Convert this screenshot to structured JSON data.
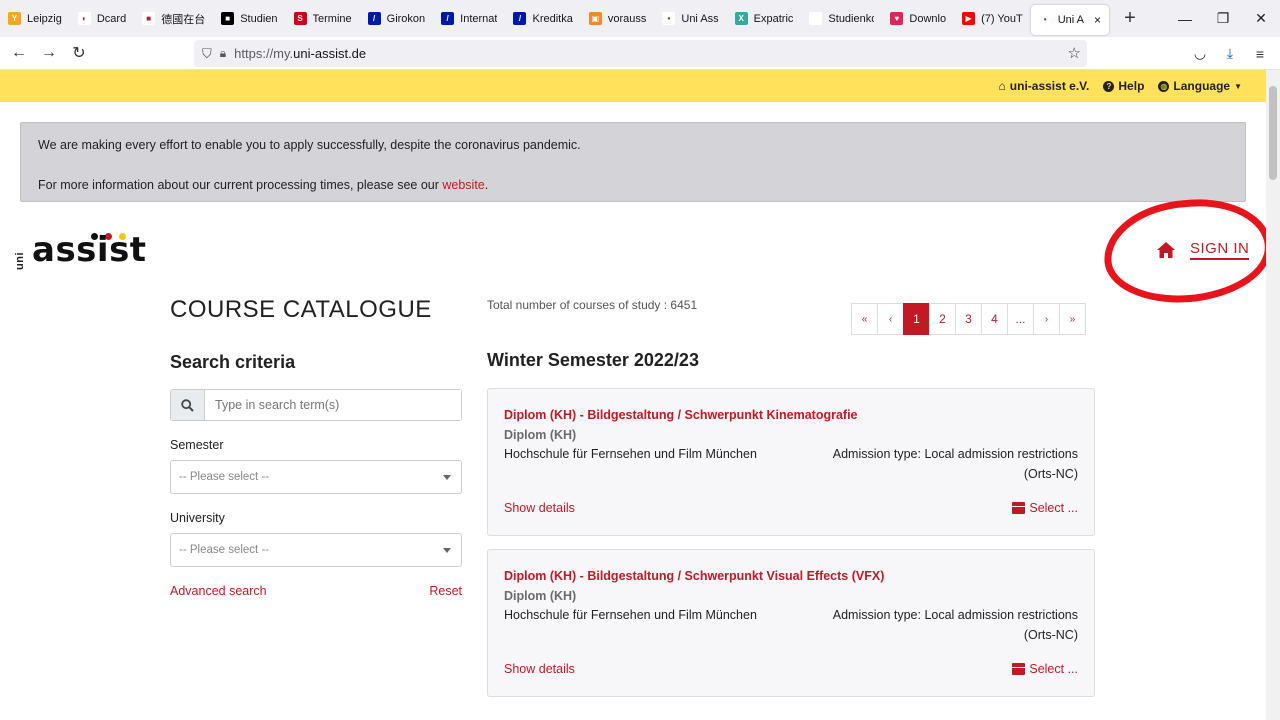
{
  "browser": {
    "tabs": [
      {
        "label": "Leipzig",
        "color": "#f5a623",
        "glyph": "Y"
      },
      {
        "label": "Dcard",
        "color": "#ffffff",
        "glyph": "◐"
      },
      {
        "label": "德國在台",
        "color": "#ffffff",
        "glyph": "■"
      },
      {
        "label": "Studien",
        "color": "#000000",
        "glyph": "■"
      },
      {
        "label": "Termine",
        "color": "#d0021b",
        "glyph": "S"
      },
      {
        "label": "Girokon",
        "color": "#0018a8",
        "glyph": "/"
      },
      {
        "label": "Internat",
        "color": "#0018a8",
        "glyph": "/"
      },
      {
        "label": "Kreditka",
        "color": "#0018a8",
        "glyph": "/"
      },
      {
        "label": "vorauss",
        "color": "#f08a24",
        "glyph": "▣"
      },
      {
        "label": "Uni Ass",
        "color": "#ffffff",
        "glyph": "•"
      },
      {
        "label": "Expatric",
        "color": "#3aa89b",
        "glyph": "X"
      },
      {
        "label": "Studienkolli",
        "color": "#ffffff",
        "glyph": ""
      },
      {
        "label": "Downlo",
        "color": "#e0245e",
        "glyph": "♥"
      },
      {
        "label": "(7) YouT",
        "color": "#ff0000",
        "glyph": "▶"
      },
      {
        "label": "Uni A",
        "color": "#ffffff",
        "glyph": "•",
        "active": true
      }
    ],
    "new_tab": "+",
    "url_prefix": "https://my.",
    "url_domain": "uni-assist.de",
    "win_min": "—",
    "win_restore": "❐",
    "win_close": "✕"
  },
  "topbar": {
    "brand": "uni-assist e.V.",
    "help": "Help",
    "language": "Language"
  },
  "notice": {
    "line1": "We are making every effort to enable you to apply successfully, despite the coronavirus pandemic.",
    "line2_prefix": "For more information about our current processing times, please see our ",
    "line2_link": "website",
    "line2_suffix": "."
  },
  "logo": {
    "uni": "uni",
    "word": "assist",
    "dot_colors": [
      "#111111",
      "#c31924",
      "#f5c518"
    ]
  },
  "signin": {
    "label": "SIGN IN"
  },
  "catalogue": {
    "title": "COURSE CATALOGUE",
    "search_title": "Search criteria",
    "search_placeholder": "Type in search term(s)",
    "semester_label": "Semester",
    "semester_value": "-- Please select --",
    "university_label": "University",
    "university_value": "-- Please select --",
    "advanced": "Advanced search",
    "reset": "Reset"
  },
  "results": {
    "total": "Total number of courses of study : 6451",
    "pager": [
      "«",
      "‹",
      "1",
      "2",
      "3",
      "4",
      "...",
      "›",
      "»"
    ],
    "active_page": "1",
    "semester": "Winter Semester 2022/23",
    "courses": [
      {
        "title": "Diplom (KH) - Bildgestaltung / Schwerpunkt Kinematografie",
        "degree": "Diplom (KH)",
        "university": "Hochschule für Fernsehen und Film München",
        "admission_1": "Admission type: Local admission restrictions",
        "admission_2": "(Orts-NC)",
        "details": "Show details",
        "select": "Select ..."
      },
      {
        "title": "Diplom (KH) - Bildgestaltung / Schwerpunkt Visual Effects (VFX)",
        "degree": "Diplom (KH)",
        "university": "Hochschule für Fernsehen und Film München",
        "admission_1": "Admission type: Local admission restrictions",
        "admission_2": "(Orts-NC)",
        "details": "Show details",
        "select": "Select ..."
      }
    ]
  },
  "colors": {
    "accent": "#c31924",
    "topbar": "#ffe15b",
    "annotation": "#e8141b"
  }
}
